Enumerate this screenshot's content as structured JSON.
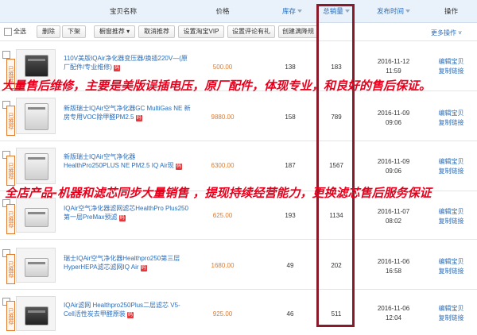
{
  "header": {
    "columns": {
      "name": "宝贝名称",
      "price": "价格",
      "stock": "库存",
      "sales": "总销量",
      "published": "发布时间",
      "actions": "操作"
    }
  },
  "toolbar": {
    "select_all": "全选",
    "delete": "删除",
    "unlist": "下架",
    "window_rec": "橱窗推荐",
    "cancel_rec": "取消推荐",
    "set_vip": "设置淘宝VIP",
    "set_comment": "设置评论有礼",
    "create_rule": "创建满降规",
    "more_actions": "更多操作"
  },
  "overlays": {
    "line1": "大量售后维修，主要是美版误插电压，原厂配件，体现专业，和良好的售后保证。",
    "line2": "全店产品-机器和滤芯同步大量销售 ，提现持续经营能力，更换滤芯售后服务保证"
  },
  "rows": [
    {
      "badge": "已推荐",
      "title": "110V美版IQAir净化器变压器/换插220V—(原厂配件/专业维修)",
      "price": "500.00",
      "stock": "138",
      "sales": "183",
      "date": "2016-11-12",
      "time": "11:59",
      "edit": "编辑宝贝",
      "copy": "复制链接"
    },
    {
      "badge": "已推荐",
      "title": "新版瑞士IQAir空气净化器GC MultiGas NE 新房专用VOC除甲醛PM2.5",
      "price": "9880.00",
      "stock": "158",
      "sales": "789",
      "date": "2016-11-09",
      "time": "09:06",
      "edit": "编辑宝贝",
      "copy": "复制链接"
    },
    {
      "badge": "已推荐",
      "title": "新版瑞士IQAir空气净化器 HealthPro250PLUS NE PM2.5 IQ Air现",
      "price": "6300.00",
      "stock": "187",
      "sales": "1567",
      "date": "2016-11-09",
      "time": "09:06",
      "edit": "编辑宝贝",
      "copy": "复制链接"
    },
    {
      "badge": "已推荐",
      "title": "IQAir空气净化器滤网滤芯HealthPro Plus250第一层PreMax预滤",
      "price": "625.00",
      "stock": "193",
      "sales": "1134",
      "date": "2016-11-07",
      "time": "08:02",
      "edit": "编辑宝贝",
      "copy": "复制链接"
    },
    {
      "badge": "已推荐",
      "title": "瑞士IQAir空气净化器Healthpro250第三层HyperHEPA滤芯滤网IQ Air",
      "price": "1680.00",
      "stock": "49",
      "sales": "202",
      "date": "2016-11-06",
      "time": "16:58",
      "edit": "编辑宝贝",
      "copy": "复制链接"
    },
    {
      "badge": "已推荐",
      "title": "IQAir滤网 Healthpro250Plus二层滤芯 V5-Cell活性炭去甲醛原装",
      "price": "925.00",
      "stock": "46",
      "sales": "511",
      "date": "2016-11-06",
      "time": "12:04",
      "edit": "编辑宝贝",
      "copy": "复制链接"
    }
  ],
  "colors": {
    "accent": "#2a6dbb",
    "price": "#e07a2f",
    "highlight": "#8a1a2a",
    "overlay_text": "#e8001c"
  }
}
